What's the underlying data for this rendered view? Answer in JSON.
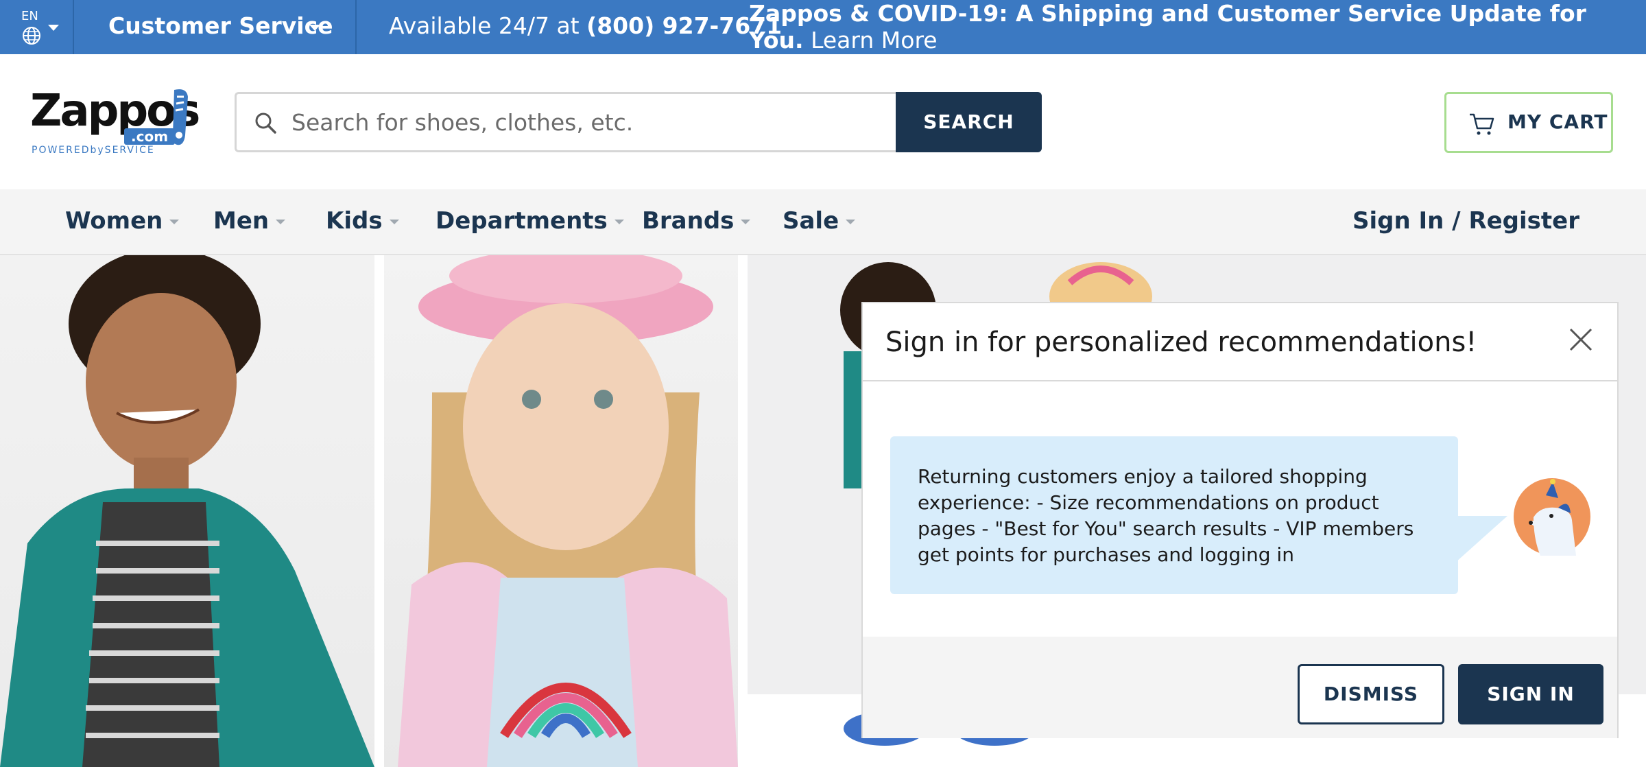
{
  "topbar": {
    "language_code": "EN",
    "customer_service_label": "Customer Service",
    "availability_text": "Available 24/7 at ",
    "phone": "(800) 927-7671",
    "covid_bold": "Zappos & COVID-19: A Shipping and Customer Service Update for You.",
    "covid_link": " Learn More"
  },
  "header": {
    "logo_word": "Zappos",
    "logo_com": ".com",
    "logo_tagline": "POWEREDbySERVICE",
    "search_placeholder": "Search for shoes, clothes, etc.",
    "search_button": "SEARCH",
    "cart_label": "MY CART"
  },
  "nav": {
    "items": [
      {
        "label": "Women"
      },
      {
        "label": "Men"
      },
      {
        "label": "Kids"
      },
      {
        "label": "Departments"
      },
      {
        "label": "Brands"
      },
      {
        "label": "Sale"
      }
    ],
    "signin": "Sign In / Register"
  },
  "modal": {
    "title": "Sign in for personalized recommendations!",
    "message": "Returning customers enjoy a tailored shopping experience: - Size recommendations on product pages - \"Best for You\" search results - VIP members get points for purchases and logging in",
    "dismiss_button": "DISMISS",
    "signin_button": "SIGN IN"
  },
  "colors": {
    "topbar": "#3b79c2",
    "navy": "#1b3550",
    "cart_border": "#a7dd8f",
    "bubble": "#d8edfb",
    "avatar_bg": "#f0955a"
  }
}
